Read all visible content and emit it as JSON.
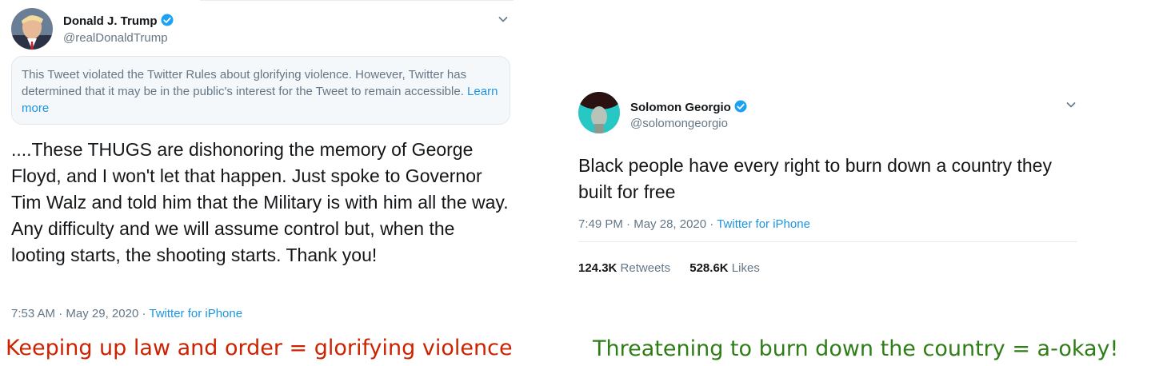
{
  "left_tweet": {
    "author_name": "Donald J. Trump",
    "author_handle": "@realDonaldTrump",
    "avatar_icon": "profile-photo-icon",
    "notice_text": "This Tweet violated the Twitter Rules about glorifying violence. However, Twitter has determined that it may be in the public's interest for the Tweet to remain accessible.",
    "notice_link": "Learn more",
    "body": "....These THUGS are dishonoring the memory of George Floyd, and I won't let that happen. Just spoke to Governor Tim Walz and told him that the Military is with him all the way. Any difficulty and we will assume control but, when the looting starts, the shooting starts. Thank you!",
    "time": "7:53 AM",
    "date": "May 29, 2020",
    "source": "Twitter for iPhone"
  },
  "right_tweet": {
    "author_name": "Solomon Georgio",
    "author_handle": "@solomongeorgio",
    "avatar_icon": "profile-photo-icon",
    "body": "Black people have every right to burn down a country they built for free",
    "time": "7:49 PM",
    "date": "May 28, 2020",
    "source": "Twitter for iPhone",
    "retweets_count": "124.3K",
    "retweets_label": "Retweets",
    "likes_count": "528.6K",
    "likes_label": "Likes"
  },
  "captions": {
    "left": "Keeping up law and order = glorifying violence",
    "right": "Threatening to burn down the country = a-okay!"
  },
  "separator": " · ",
  "colors": {
    "left_caption": "#cc2200",
    "right_caption": "#2e7d16",
    "link": "#1b95e0",
    "verified": "#1da1f2"
  }
}
